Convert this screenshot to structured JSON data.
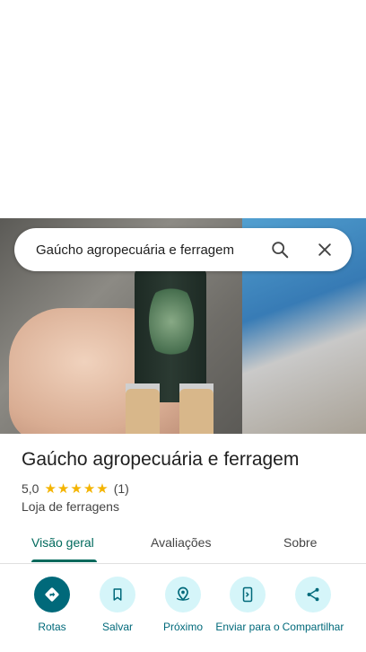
{
  "search": {
    "query": "Gaúcho agropecuária e ferragem"
  },
  "place": {
    "name": "Gaúcho agropecuária e ferragem",
    "rating": "5,0",
    "stars_filled": 5,
    "review_count": "(1)",
    "category": "Loja de ferragens"
  },
  "tabs": [
    {
      "label": "Visão geral",
      "active": true
    },
    {
      "label": "Avaliações",
      "active": false
    },
    {
      "label": "Sobre",
      "active": false
    }
  ],
  "actions": [
    {
      "label": "Rotas",
      "icon": "directions-icon"
    },
    {
      "label": "Salvar",
      "icon": "bookmark-icon"
    },
    {
      "label": "Próximo",
      "icon": "nearby-icon"
    },
    {
      "label": "Enviar para o",
      "icon": "send-to-phone-icon"
    },
    {
      "label": "Compartilhar",
      "icon": "share-icon"
    }
  ],
  "colors": {
    "accent": "#00697a",
    "star": "#f4b400",
    "chip_bg": "#d5f5f9"
  }
}
